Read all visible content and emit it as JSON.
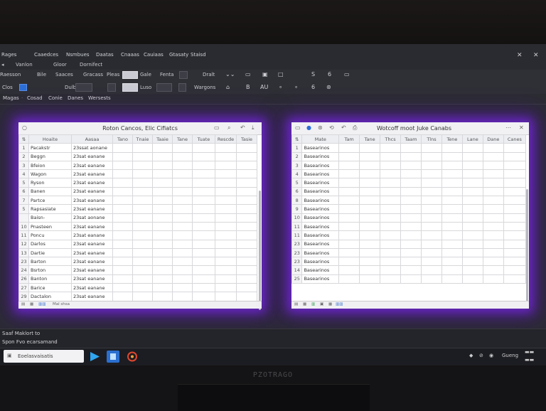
{
  "menu": {
    "items": [
      "Rages",
      "Caaedces",
      "Nsmbues",
      "Daatas",
      "Cnaaas",
      "Cauiaas",
      "Gtasaty",
      "Staisd"
    ]
  },
  "subbar": {
    "items": [
      "Vanlon",
      "Gloor",
      "Dornifect"
    ]
  },
  "ribbon": {
    "row1": [
      "Raesson",
      "Bile",
      "Saaces",
      "Gracass",
      "Pleas",
      "Gale",
      "Fenta",
      "Dralt"
    ],
    "row2": [
      "Clos",
      "Dulb",
      "Luso",
      "Wargons"
    ],
    "glyph_b": "B",
    "glyph_au": "AU",
    "glyph_s": "S",
    "glyph_6": "6",
    "glyph_8": "6"
  },
  "tabs": {
    "items": [
      "Magas",
      "Cosad",
      "Conie",
      "Danes",
      "Wersests"
    ]
  },
  "left_panel": {
    "title": "Roton Cancos, Elic Cifiatcs",
    "headers": [
      "Hoaite",
      "Aasaa",
      "Tano",
      "Tnaie",
      "Taaie",
      "Tane",
      "Tuate",
      "Rescde",
      "Tasie"
    ],
    "rows": [
      [
        "1",
        "Pacakstr",
        "23ssat aonane"
      ],
      [
        "2",
        "Beggn",
        "23sat eanane"
      ],
      [
        "3",
        "Bfeion",
        "23sat eanane"
      ],
      [
        "4",
        "Wagon",
        "23sat eanane"
      ],
      [
        "5",
        "Ryson",
        "23sat eanane"
      ],
      [
        "6",
        "Banen",
        "23sat eanane"
      ],
      [
        "7",
        "Partce",
        "23sat eanane"
      ],
      [
        "5",
        "Rapsasiate",
        "23sat eanane"
      ],
      [
        "",
        "Baisn-",
        "23sat aonane"
      ],
      [
        "10",
        "Pnasteen",
        "23sat eanane"
      ],
      [
        "11",
        "Poncu",
        "23sat eanane"
      ],
      [
        "12",
        "Darlos",
        "23sat eanane"
      ],
      [
        "13",
        "Dartie",
        "23sat eanane"
      ],
      [
        "23",
        "Barton",
        "23sat eanane"
      ],
      [
        "24",
        "Bsrton",
        "23sat eanane"
      ],
      [
        "26",
        "Banton",
        "23sat eanane"
      ],
      [
        "27",
        "Barice",
        "23sat eanane"
      ],
      [
        "29",
        "Dactalon",
        "23sat eanane"
      ]
    ],
    "status": "Mal shsa"
  },
  "right_panel": {
    "title": "Wotcoff moot Juke Canabs",
    "headers": [
      "Mate",
      "Tam",
      "Tane",
      "Thcs",
      "Taam",
      "Tlns",
      "Tene",
      "Lane",
      "Dane",
      "Canes"
    ],
    "rows": [
      [
        "1",
        "Basearinos"
      ],
      [
        "2",
        "Basearinos"
      ],
      [
        "3",
        "Basearinos"
      ],
      [
        "4",
        "Basearinos"
      ],
      [
        "5",
        "Basearinos"
      ],
      [
        "6",
        "Basearinos"
      ],
      [
        "8",
        "Basearinos"
      ],
      [
        "9",
        "Basearinos"
      ],
      [
        "10",
        "Basearinos"
      ],
      [
        "11",
        "Basearinos"
      ],
      [
        "11",
        "Basearinos"
      ],
      [
        "23",
        "Basearinos"
      ],
      [
        "23",
        "Basearinos"
      ],
      [
        "23",
        "Basearinos"
      ],
      [
        "14",
        "Basearinos"
      ],
      [
        "25",
        "Basearinos"
      ]
    ]
  },
  "statusbar": {
    "line1": "Saaf  Maklort to",
    "line2": "Spon Fvo ecarsamand"
  },
  "taskbar": {
    "search_text": "Eoelasvaisatis",
    "tray_text": "Gueng"
  },
  "monitor": {
    "brand": "PZOTRAGO"
  },
  "colors": {
    "glow": "#7a2cf0",
    "screen": "#2a2b31"
  }
}
